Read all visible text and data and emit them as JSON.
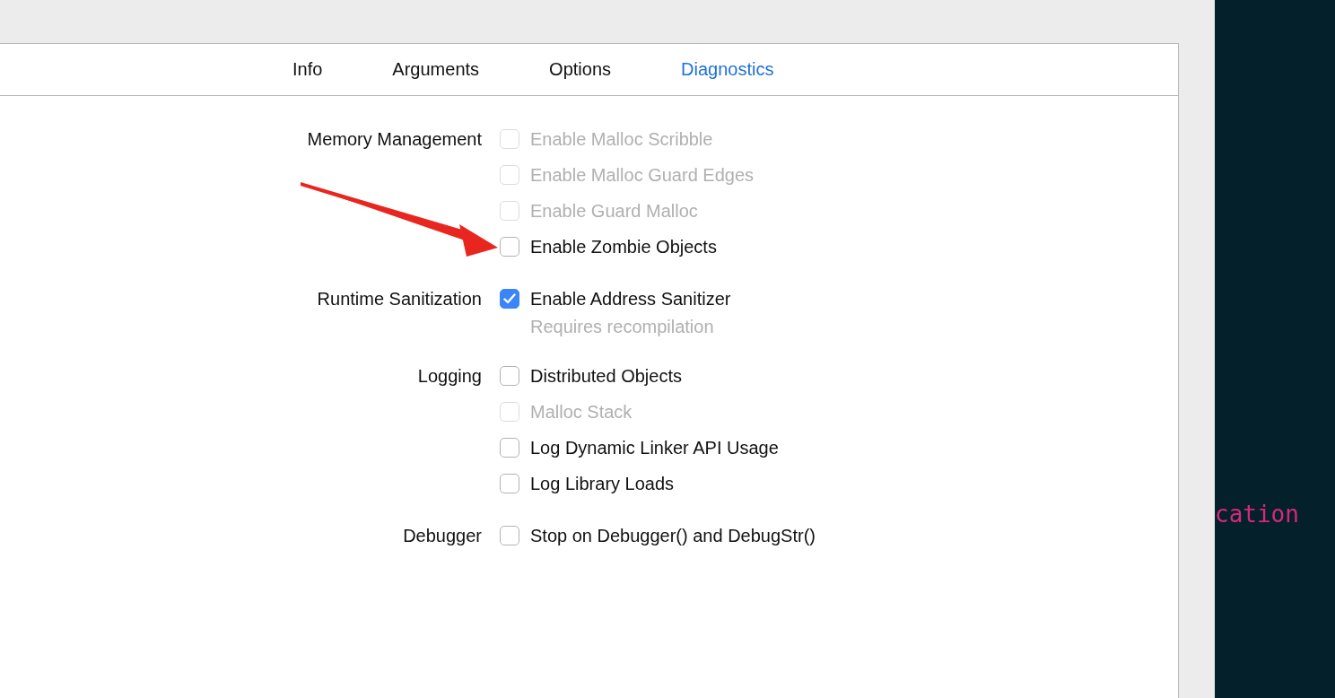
{
  "tabs": [
    {
      "label": "Info",
      "selected": false
    },
    {
      "label": "Arguments",
      "selected": false
    },
    {
      "label": "Options",
      "selected": false
    },
    {
      "label": "Diagnostics",
      "selected": true
    }
  ],
  "sections": [
    {
      "label": "Memory Management",
      "options": [
        {
          "label": "Enable Malloc Scribble",
          "checked": false,
          "disabled": true
        },
        {
          "label": "Enable Malloc Guard Edges",
          "checked": false,
          "disabled": true
        },
        {
          "label": "Enable Guard Malloc",
          "checked": false,
          "disabled": true
        },
        {
          "label": "Enable Zombie Objects",
          "checked": false,
          "disabled": false
        }
      ]
    },
    {
      "label": "Runtime Sanitization",
      "options": [
        {
          "label": "Enable Address Sanitizer",
          "checked": true,
          "disabled": false,
          "note": "Requires recompilation"
        }
      ]
    },
    {
      "label": "Logging",
      "options": [
        {
          "label": "Distributed Objects",
          "checked": false,
          "disabled": false
        },
        {
          "label": "Malloc Stack",
          "checked": false,
          "disabled": true
        },
        {
          "label": "Log Dynamic Linker API Usage",
          "checked": false,
          "disabled": false
        },
        {
          "label": "Log Library Loads",
          "checked": false,
          "disabled": false
        }
      ]
    },
    {
      "label": "Debugger",
      "options": [
        {
          "label": "Stop on Debugger() and DebugStr()",
          "checked": false,
          "disabled": false
        }
      ]
    }
  ],
  "side_panel": {
    "code_text": "cation"
  }
}
